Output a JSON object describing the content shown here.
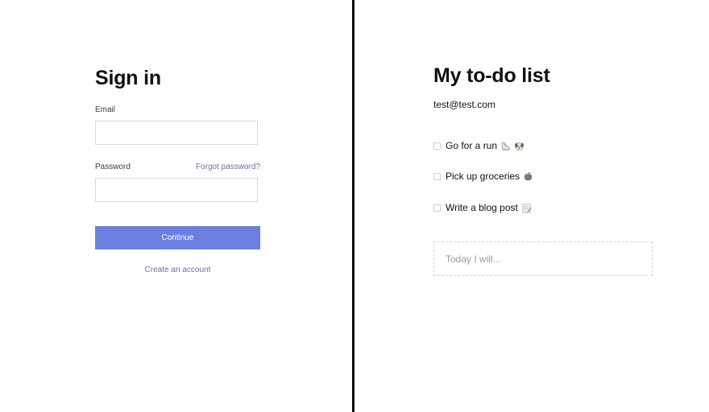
{
  "signin": {
    "title": "Sign in",
    "email_label": "Email",
    "email_value": "",
    "password_label": "Password",
    "password_value": "",
    "forgot_password": "Forgot password?",
    "continue_label": "Continue",
    "create_account": "Create an account",
    "accent_color": "#6b7fe1",
    "link_color": "#6d6d9e"
  },
  "todo": {
    "title": "My to-do list",
    "user_email": "test@test.com",
    "items": [
      {
        "label": "Go for a run",
        "checked": false,
        "icons": [
          "shoe-emoji-icon",
          "dog-emoji-icon"
        ]
      },
      {
        "label": "Pick up groceries",
        "checked": false,
        "icons": [
          "apple-emoji-icon"
        ]
      },
      {
        "label": "Write a blog post",
        "checked": false,
        "icons": [
          "memo-emoji-icon"
        ]
      }
    ],
    "new_item_placeholder": "Today I will..."
  }
}
